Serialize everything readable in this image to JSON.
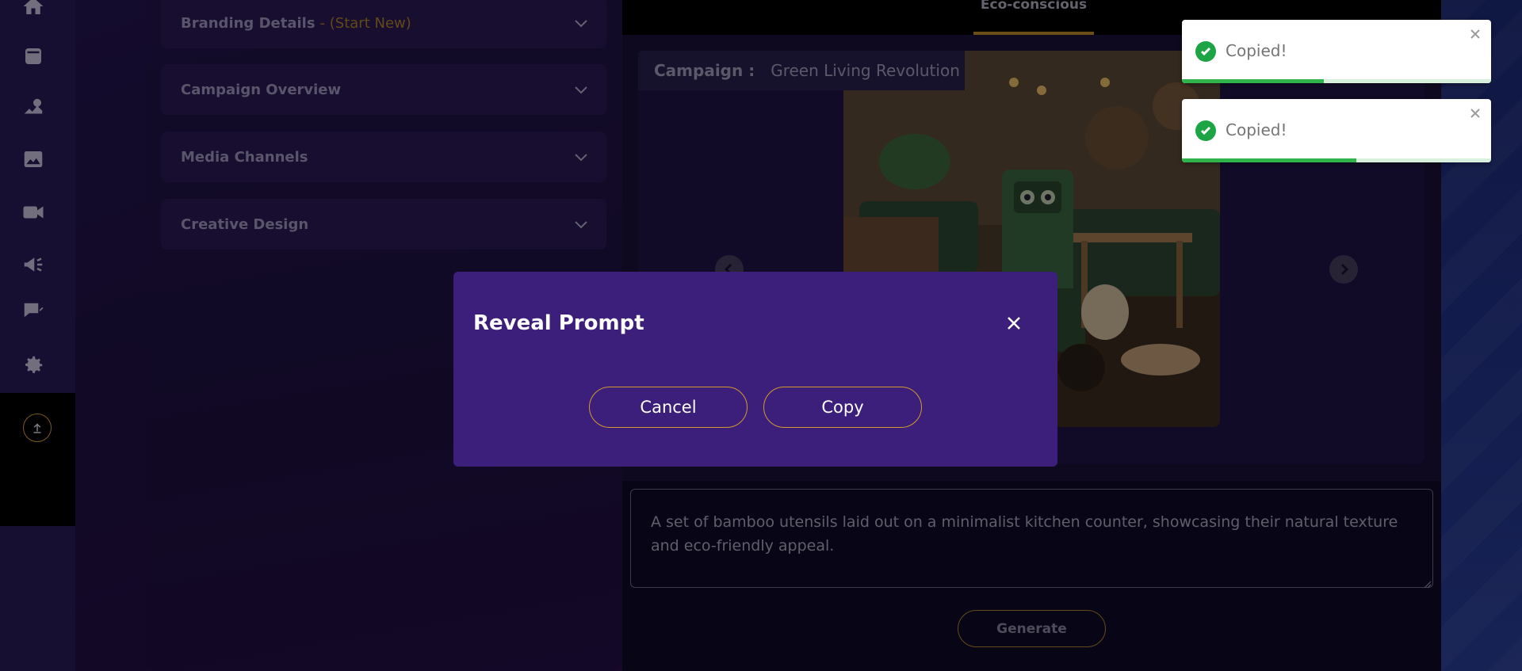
{
  "sidebar": {
    "icons": [
      "home-icon",
      "archive-icon",
      "campaign-icon",
      "image-icon",
      "video-icon",
      "megaphone-icon",
      "script-icon",
      "settings-icon"
    ],
    "upload_icon": "upload-icon"
  },
  "accordion": {
    "items": [
      {
        "label": "Branding Details",
        "suffix": "- (Start New)"
      },
      {
        "label": "Campaign Overview"
      },
      {
        "label": "Media Channels"
      },
      {
        "label": "Creative Design"
      }
    ]
  },
  "main": {
    "tab_label": "Eco-conscious",
    "campaign_key": "Campaign :",
    "campaign_value": "Green Living Revolution",
    "prompt_text": "A set of bamboo utensils laid out on a minimalist kitchen counter, showcasing their natural texture and eco-friendly appeal.",
    "generate_label": "Generate"
  },
  "modal": {
    "title": "Reveal Prompt",
    "cancel_label": "Cancel",
    "copy_label": "Copy"
  },
  "toasts": [
    {
      "message": "Copied!",
      "progress": 0.46
    },
    {
      "message": "Copied!",
      "progress": 0.565
    }
  ],
  "colors": {
    "accent": "#c58f2c",
    "modal_bg": "#3b1f7a",
    "success": "#1ca445"
  }
}
